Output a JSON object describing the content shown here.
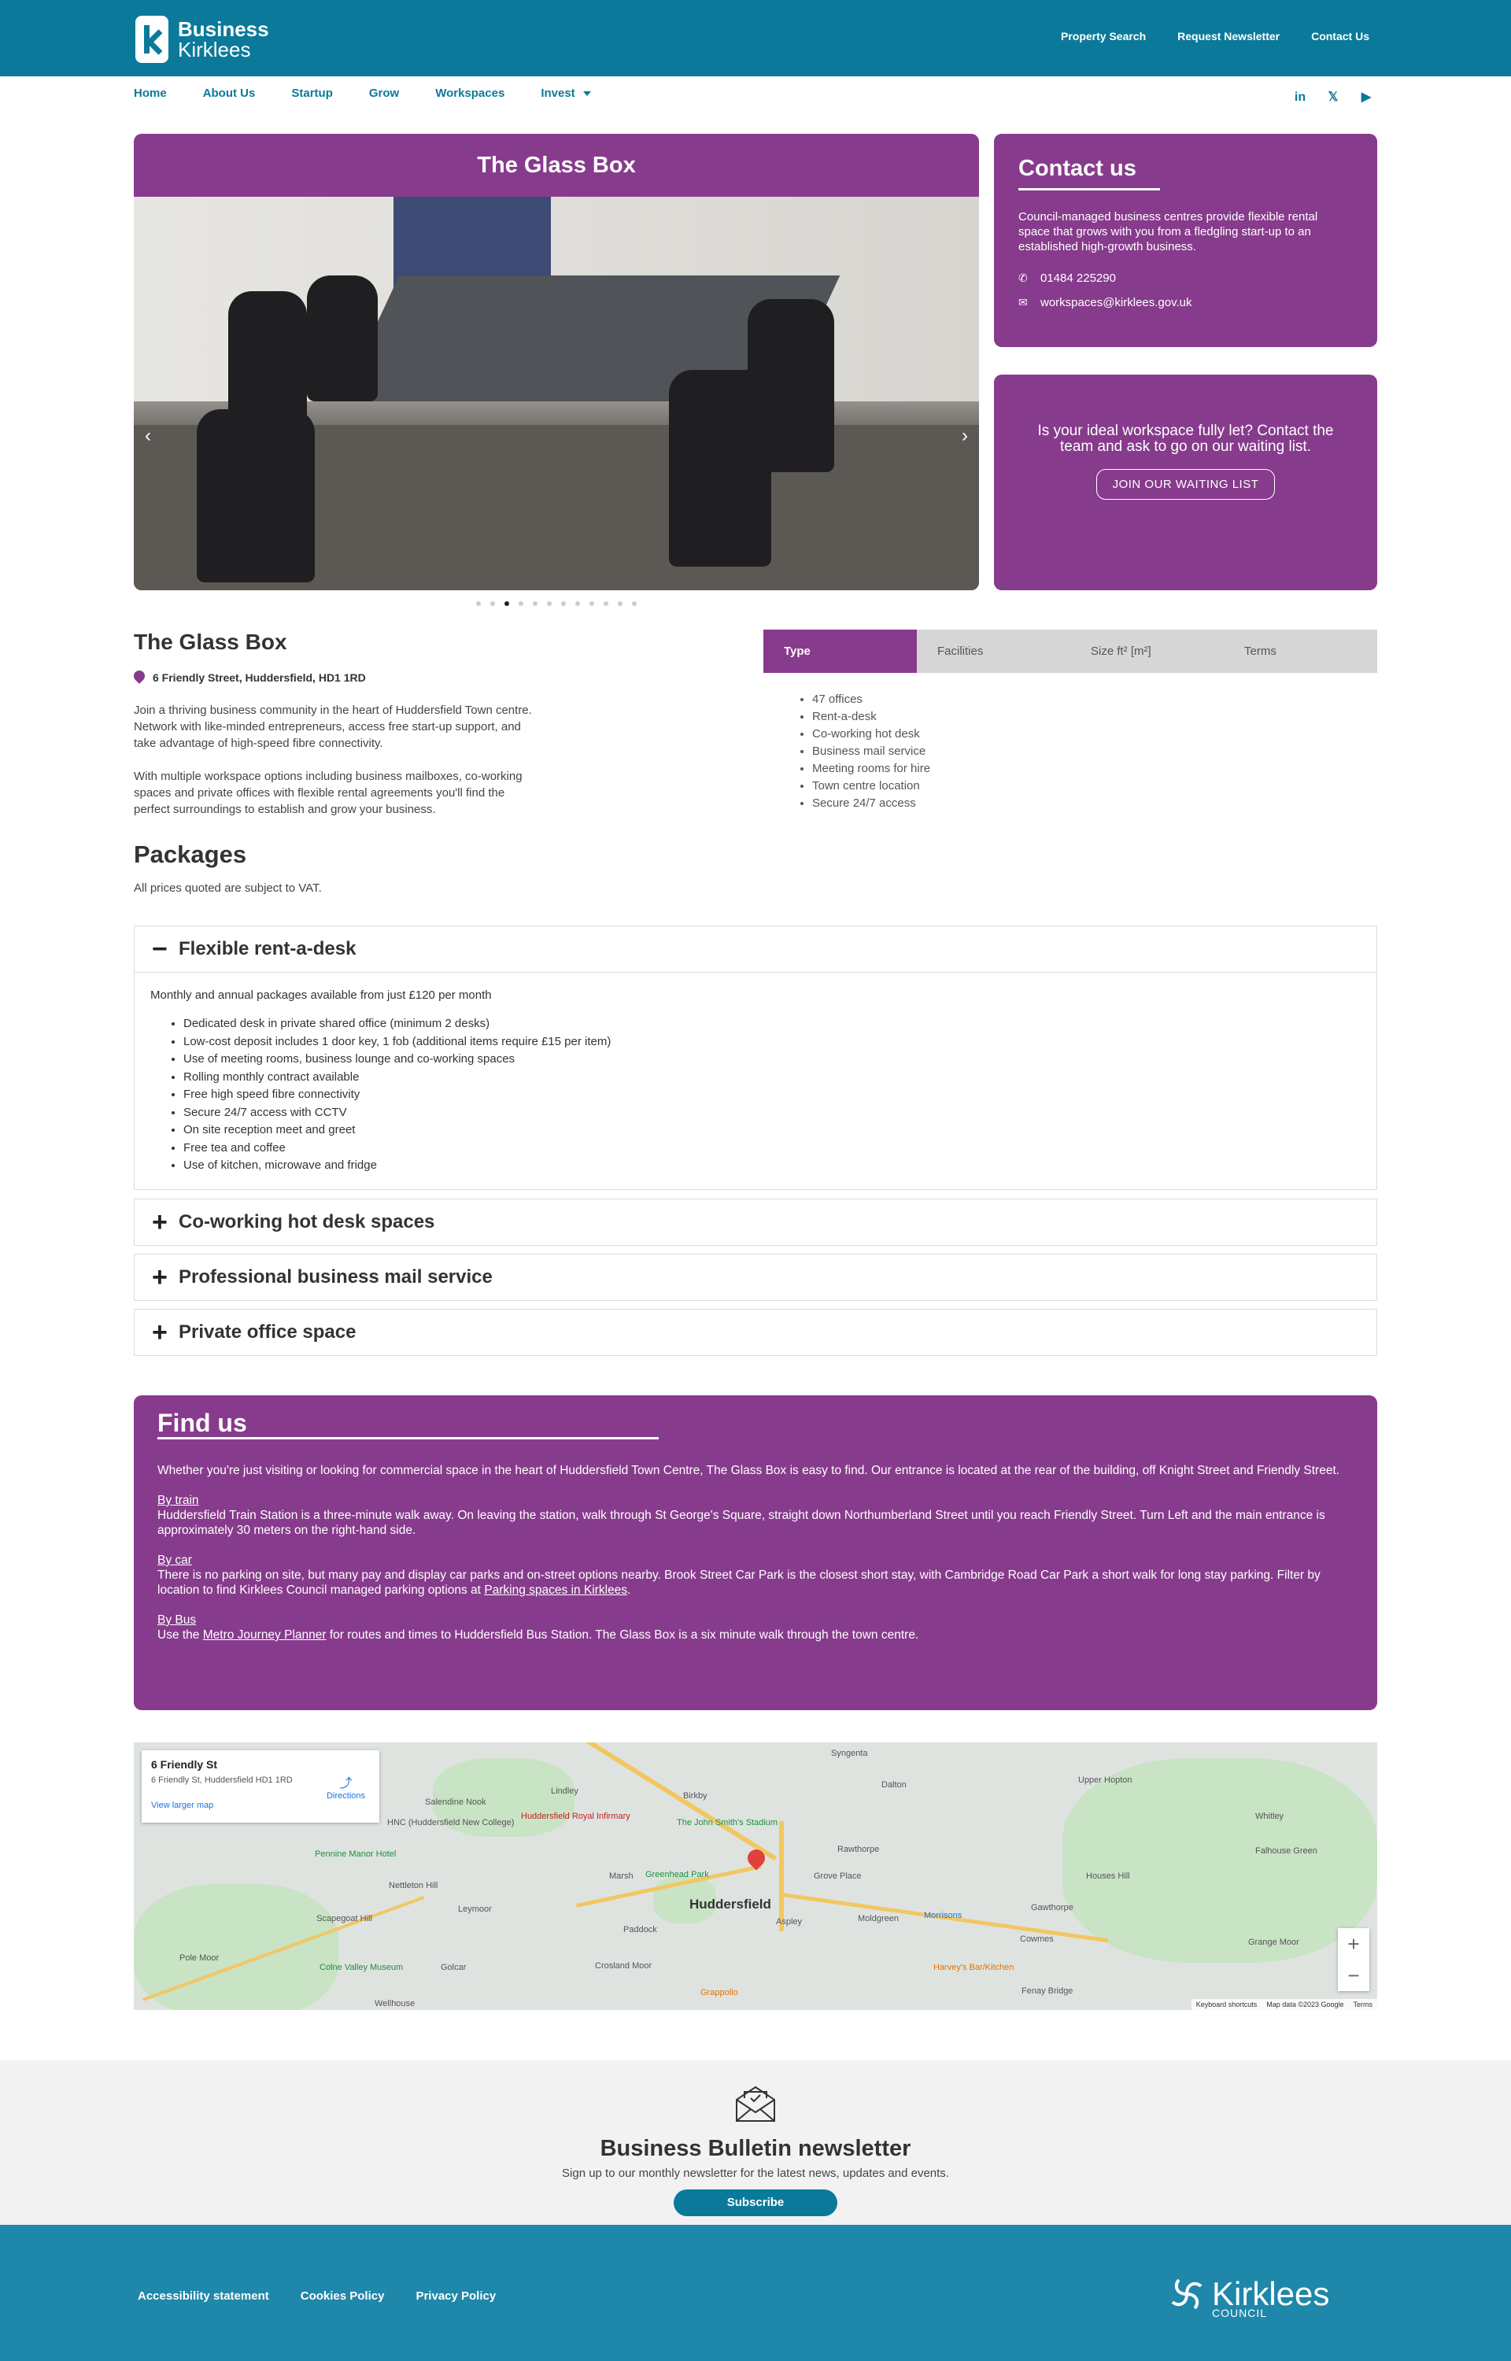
{
  "header": {
    "logo_line1": "Business",
    "logo_line2": "Kirklees",
    "top_links": [
      "Property Search",
      "Request Newsletter",
      "Contact Us"
    ]
  },
  "nav": {
    "items": [
      "Home",
      "About Us",
      "Startup",
      "Grow",
      "Workspaces",
      "Invest"
    ],
    "social_icons": [
      "linkedin-icon",
      "x-icon",
      "youtube-icon"
    ]
  },
  "hero": {
    "title": "The Glass Box",
    "prev": "‹",
    "next": "›",
    "slides_total": 12,
    "active_slide": 3
  },
  "contact": {
    "title": "Contact us",
    "text": "Council-managed business centres provide flexible rental space that grows with you from a fledgling start-up to an established high-growth business.",
    "phone": "01484 225290",
    "email": "workspaces@kirklees.gov.uk"
  },
  "waiting": {
    "text": "Is your ideal workspace fully let? Contact the team and ask to go on our waiting list.",
    "button": "JOIN OUR WAITING LIST"
  },
  "detail": {
    "title": "The Glass Box",
    "address": "6 Friendly Street, Huddersfield, HD1 1RD",
    "para1": "Join a thriving business community in the heart of Huddersfield Town centre.  Network with like-minded entrepreneurs, access free start-up support, and take advantage of high-speed fibre connectivity.",
    "para2": "With multiple workspace options including business mailboxes, co-working spaces and private offices with flexible rental agreements you'll find the perfect surroundings to establish and grow your business."
  },
  "tabs": {
    "labels": [
      "Type",
      "Facilities",
      "Size ft² [m²]",
      "Terms"
    ],
    "type_items": [
      "47 offices",
      "Rent-a-desk",
      "Co-working hot desk",
      "Business mail service",
      "Meeting rooms for hire",
      "Town centre location",
      "Secure 24/7 access"
    ]
  },
  "packages": {
    "title": "Packages",
    "vat": "All prices quoted are subject to VAT.",
    "open": {
      "title": "Flexible rent-a-desk",
      "intro": "Monthly and annual packages available from just £120 per month",
      "items": [
        "Dedicated desk in private shared office (minimum 2 desks)",
        "Low-cost deposit includes 1 door key, 1 fob (additional items require £15 per item)",
        "Use of meeting rooms, business lounge and co-working spaces",
        "Rolling monthly contract available",
        "Free high speed fibre connectivity",
        "Secure 24/7 access with CCTV",
        "On site reception meet and greet",
        "Free tea and coffee",
        "Use of kitchen, microwave and fridge"
      ]
    },
    "closed": [
      "Co-working hot desk spaces",
      "Professional business mail service",
      "Private office space"
    ]
  },
  "findus": {
    "title": "Find us",
    "intro": "Whether you're just visiting or looking for commercial space in the heart of Huddersfield Town Centre, The Glass Box is easy to find. Our entrance is located at the rear of the building, off Knight Street and Friendly Street.",
    "train_head": "By train",
    "train": "Huddersfield Train Station is a three-minute walk away. On leaving the station, walk through St George's Square, straight down Northumberland Street until you reach Friendly Street. Turn Left and the main entrance is approximately 30 meters on the right-hand side.",
    "car_head": "By car",
    "car_pre": "There is no parking on site, but many pay and display car parks and on-street options nearby. Brook Street Car Park is the closest short stay, with Cambridge Road Car Park a short walk for long stay parking. Filter by location to find Kirklees Council managed parking options at ",
    "car_link": "Parking spaces in Kirklees",
    "car_post": ".",
    "bus_head": "By Bus",
    "bus_pre": "Use the ",
    "bus_link": "Metro Journey Planner",
    "bus_post": " for routes and times to Huddersfield Bus Station. The Glass Box is a six minute walk through the town centre."
  },
  "map": {
    "card_name": "6 Friendly St",
    "card_address": "6 Friendly St, Huddersfield HD1 1RD",
    "directions": "Directions",
    "larger": "View larger map",
    "city": "Huddersfield",
    "labels": [
      "Syngenta",
      "Dalton",
      "Upper Hopton",
      "Whitley",
      "Falhouse Green",
      "Birkby",
      "Huddersfield Royal Infirmary",
      "HNC (Huddersfield New College)",
      "Pennine Manor Hotel",
      "Nettleton Hill",
      "Scapegoat Hill",
      "Pole Moor",
      "Colne Valley Museum",
      "Golcar",
      "Paddock",
      "Crosland Moor",
      "Grappollo",
      "Wellhouse",
      "The John Smith's Stadium",
      "Greenhead Park",
      "Morrisons",
      "Gawthorpe",
      "Houses Hill",
      "Grange Moor",
      "Fenay Bridge",
      "Harvey's Bar/Kitchen",
      "Cowmes",
      "Lindley",
      "Marsh",
      "Leymoor",
      "Aspley",
      "Moldgreen",
      "Rawthorpe",
      "Grove Place",
      "Salendine Nook"
    ],
    "footer": [
      "Keyboard shortcuts",
      "Map data ©2023 Google",
      "Terms"
    ],
    "zoom_in": "+",
    "zoom_out": "−"
  },
  "newsletter": {
    "title": "Business Bulletin newsletter",
    "subtitle": "Sign up to our monthly newsletter for the latest news, updates and events.",
    "button": "Subscribe"
  },
  "footer": {
    "links": [
      "Accessibility statement",
      "Cookies Policy",
      "Privacy Policy"
    ],
    "brand": "Kirklees",
    "brand_sub": "COUNCIL"
  }
}
